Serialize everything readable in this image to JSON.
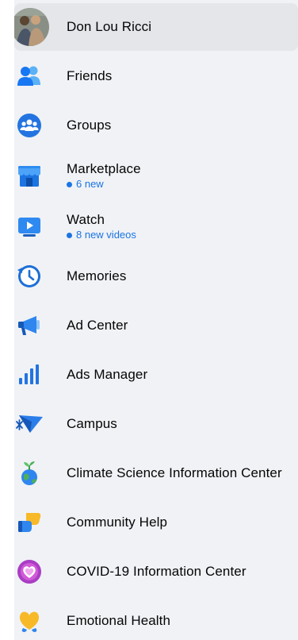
{
  "profile": {
    "name": "Don Lou Ricci",
    "avatar_icon": "profile-photo"
  },
  "menu": [
    {
      "label": "Friends",
      "icon": "friends-icon"
    },
    {
      "label": "Groups",
      "icon": "groups-icon"
    },
    {
      "label": "Marketplace",
      "icon": "marketplace-icon",
      "sub": "6 new"
    },
    {
      "label": "Watch",
      "icon": "watch-icon",
      "sub": "8 new videos"
    },
    {
      "label": "Memories",
      "icon": "memories-icon"
    },
    {
      "label": "Ad Center",
      "icon": "megaphone-icon"
    },
    {
      "label": "Ads Manager",
      "icon": "bar-chart-icon"
    },
    {
      "label": "Campus",
      "icon": "campus-icon"
    },
    {
      "label": "Climate Science Information Center",
      "icon": "globe-sprout-icon"
    },
    {
      "label": "Community Help",
      "icon": "helping-hand-icon"
    },
    {
      "label": "COVID-19 Information Center",
      "icon": "heart-shield-icon"
    },
    {
      "label": "Emotional Health",
      "icon": "emotional-health-icon"
    }
  ],
  "colors": {
    "accent": "#1b74e4",
    "panel": "#f0f2f5",
    "selected": "#e4e6e9"
  }
}
